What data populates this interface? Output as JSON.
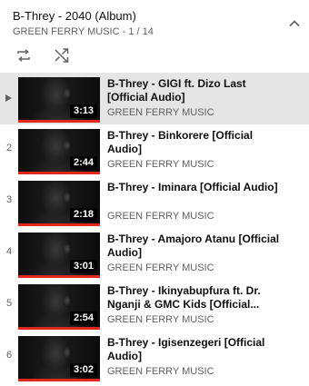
{
  "playlist": {
    "title": "B-Threy - 2040 (Album)",
    "subtitle": "GREEN FERRY MUSIC - 1 / 14"
  },
  "controls": {
    "loop_icon": "loop-icon",
    "shuffle_icon": "shuffle-icon",
    "collapse_icon": "chevron-up-icon"
  },
  "colors": {
    "progress": "#e0291c",
    "active_row": "#e5e5e5"
  },
  "items": [
    {
      "index": "",
      "title": "B-Threy - GIGI ft. Dizo Last [Official Audio]",
      "channel": "GREEN FERRY MUSIC",
      "duration": "3:13",
      "watched": 1.0,
      "active": true
    },
    {
      "index": "2",
      "title": "B-Threy - Binkorere [Official Audio]",
      "channel": "GREEN FERRY MUSIC",
      "duration": "2:44",
      "watched": 1.0
    },
    {
      "index": "3",
      "title": "B-Threy - Iminara [Official Audio]",
      "channel": "GREEN FERRY MUSIC",
      "duration": "2:18",
      "watched": 1.0
    },
    {
      "index": "4",
      "title": "B-Threy - Amajoro Atanu [Official Audio]",
      "channel": "GREEN FERRY MUSIC",
      "duration": "3:01",
      "watched": 1.0
    },
    {
      "index": "5",
      "title": "B-Threy - Ikinyabupfura ft. Dr. Nganji & GMC Kids [Official...",
      "channel": "GREEN FERRY MUSIC",
      "duration": "2:54",
      "watched": 1.0
    },
    {
      "index": "6",
      "title": "B-Threy - Igisenzegeri [Official Audio]",
      "channel": "GREEN FERRY MUSIC",
      "duration": "3:02",
      "watched": 1.0
    }
  ]
}
